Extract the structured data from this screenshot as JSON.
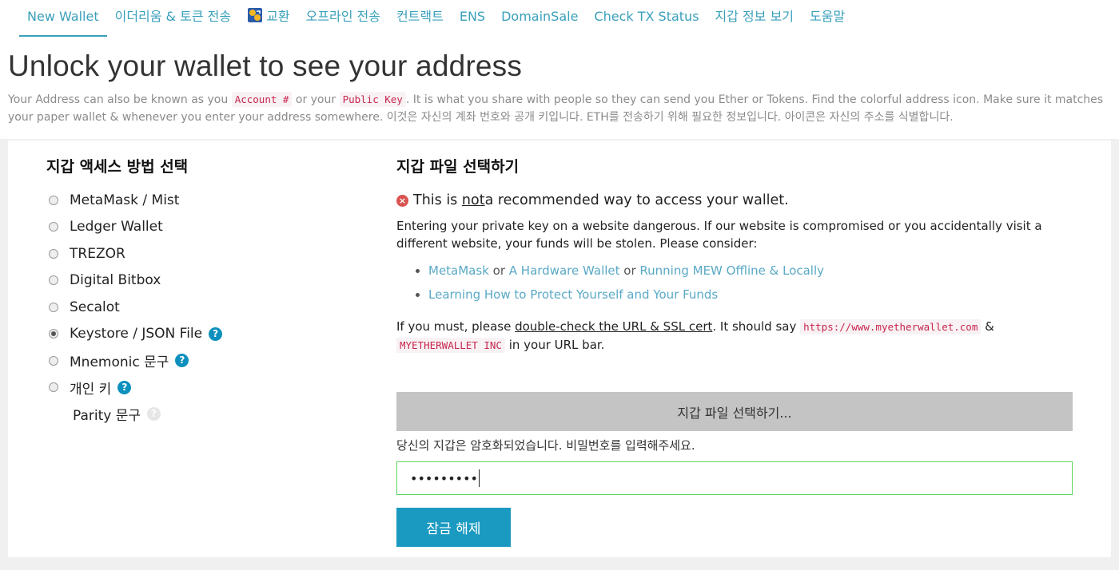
{
  "nav": {
    "items": [
      "New Wallet",
      "이더리움 & 토큰 전송",
      "교환",
      "오프라인 전송",
      "컨트랙트",
      "ENS",
      "DomainSale",
      "Check TX Status",
      "지갑 정보 보기",
      "도움말"
    ]
  },
  "header": {
    "title": "Unlock your wallet to see your address",
    "desc_part1": "Your Address can also be known as you ",
    "code_account": "Account #",
    "desc_part2": " or your ",
    "code_public_key": "Public Key",
    "desc_part3": ". It is what you share with people so they can send you Ether or Tokens. Find the colorful address icon. Make sure it matches your paper wallet & whenever you enter your address somewhere. 이것은 자신의 계좌 번호와 공개 키입니다. ETH를 전송하기 위해 필요한 정보입니다. 아이콘은 자신의 주소를 식별합니다."
  },
  "access": {
    "title": "지갑 액세스 방법 선택",
    "options": [
      {
        "label": "MetaMask / Mist",
        "checked": false
      },
      {
        "label": "Ledger Wallet",
        "checked": false
      },
      {
        "label": "TREZOR",
        "checked": false
      },
      {
        "label": "Digital Bitbox",
        "checked": false
      },
      {
        "label": "Secalot",
        "checked": false
      },
      {
        "label": "Keystore / JSON File",
        "checked": true
      },
      {
        "label": "Mnemonic 문구",
        "checked": false
      },
      {
        "label": "개인 키",
        "checked": false
      }
    ],
    "parity_label": "Parity 문구",
    "help_glyph": "?"
  },
  "file_section": {
    "title": "지갑 파일 선택하기",
    "warn_pre": "This is ",
    "warn_not": "not",
    "warn_post": " a recommended way to access your wallet.",
    "warn_icon": "×",
    "para": "Entering your private key on a website dangerous. If our website is compromised or you accidentally visit a different website, your funds will be stolen. Please consider:",
    "link_metamask": "MetaMask",
    "or1": " or ",
    "link_hardware": "A Hardware Wallet",
    "or2": " or ",
    "link_offline": "Running MEW Offline & Locally",
    "link_learning": "Learning How to Protect Yourself and Your Funds",
    "must_pre": "If you must, please ",
    "must_link": "double-check the URL & SSL cert",
    "must_mid": ". It should say ",
    "must_url": "https://www.myetherwallet.com",
    "must_amp": " & ",
    "must_inc": "MYETHERWALLET INC",
    "must_post": " in your URL bar.",
    "file_button": "지갑 파일 선택하기...",
    "encrypted_msg": "당신의 지갑은 암호화되었습니다. 비밀번호를 입력해주세요.",
    "password_value": "•••••••••",
    "unlock_button": "잠금 해제"
  }
}
